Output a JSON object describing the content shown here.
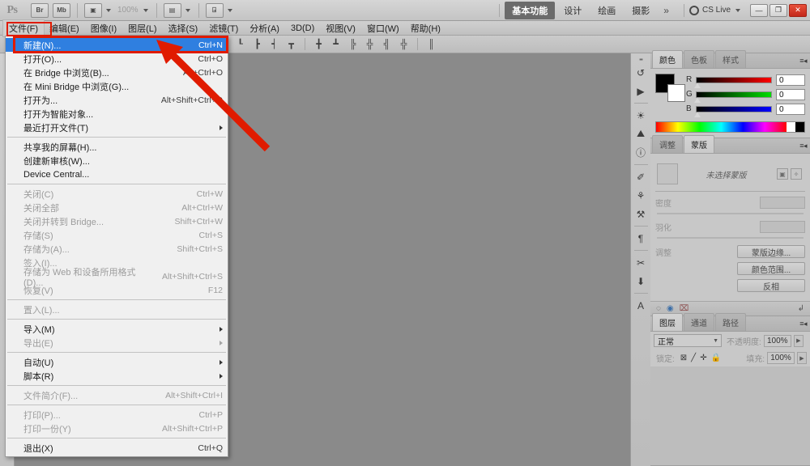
{
  "app": {
    "logo": "Ps",
    "zoom_level": "100%",
    "toolbar_icons": [
      {
        "name": "bridge-icon",
        "label": "Br"
      },
      {
        "name": "mini-bridge-icon",
        "label": "Mb"
      },
      {
        "name": "screen-mode-icon",
        "label": "▣"
      },
      {
        "name": "arrange-documents-icon",
        "label": "▤"
      },
      {
        "name": "extras-icon",
        "label": "⍈"
      }
    ]
  },
  "workspace": {
    "tabs": [
      {
        "name": "essentials",
        "label": "基本功能",
        "active": true
      },
      {
        "name": "design",
        "label": "设计",
        "active": false
      },
      {
        "name": "painting",
        "label": "绘画",
        "active": false
      },
      {
        "name": "photography",
        "label": "摄影",
        "active": false
      }
    ],
    "more": "»",
    "cs_live": "CS Live",
    "window_buttons": [
      {
        "name": "minimize-button",
        "glyph": "—"
      },
      {
        "name": "restore-button",
        "glyph": "❐"
      },
      {
        "name": "close-button",
        "glyph": "✕"
      }
    ]
  },
  "menubar": {
    "items": [
      {
        "name": "menu-file",
        "label": "文件(F)",
        "open": true
      },
      {
        "name": "menu-edit",
        "label": "编辑(E)",
        "open": false
      },
      {
        "name": "menu-image",
        "label": "图像(I)",
        "open": false
      },
      {
        "name": "menu-layer",
        "label": "图层(L)",
        "open": false
      },
      {
        "name": "menu-select",
        "label": "选择(S)",
        "open": false
      },
      {
        "name": "menu-filter",
        "label": "滤镜(T)",
        "open": false
      },
      {
        "name": "menu-analysis",
        "label": "分析(A)",
        "open": false
      },
      {
        "name": "menu-3d",
        "label": "3D(D)",
        "open": false
      },
      {
        "name": "menu-view",
        "label": "视图(V)",
        "open": false
      },
      {
        "name": "menu-window",
        "label": "窗口(W)",
        "open": false
      },
      {
        "name": "menu-help",
        "label": "帮助(H)",
        "open": false
      }
    ]
  },
  "options_bar": {
    "icons": [
      {
        "name": "align-left-edges-icon",
        "glyph": "┖"
      },
      {
        "name": "align-horizontal-centers-icon",
        "glyph": "┣"
      },
      {
        "name": "align-right-edges-icon",
        "glyph": "┥"
      },
      {
        "name": "align-top-edges-icon",
        "glyph": "┳"
      },
      {
        "name": "align-vertical-centers-icon",
        "glyph": "╋"
      },
      {
        "name": "align-bottom-edges-icon",
        "glyph": "┻"
      },
      {
        "name": "distribute-top-icon",
        "glyph": "╠"
      },
      {
        "name": "distribute-center-icon",
        "glyph": "╬"
      },
      {
        "name": "distribute-bottom-icon",
        "glyph": "╣"
      },
      {
        "name": "auto-align-layers-icon",
        "glyph": "║"
      }
    ]
  },
  "file_menu": {
    "items": [
      {
        "name": "menu-new",
        "label": "新建(N)...",
        "shortcut": "Ctrl+N",
        "selected": true,
        "disabled": false,
        "submenu": false
      },
      {
        "name": "menu-open",
        "label": "打开(O)...",
        "shortcut": "Ctrl+O",
        "selected": false,
        "disabled": false,
        "submenu": false
      },
      {
        "name": "menu-browse-in-bridge",
        "label": "在 Bridge 中浏览(B)...",
        "shortcut": "Alt+Ctrl+O",
        "selected": false,
        "disabled": false,
        "submenu": false
      },
      {
        "name": "menu-browse-in-mini-bridge",
        "label": "在 Mini Bridge 中浏览(G)...",
        "shortcut": "",
        "selected": false,
        "disabled": false,
        "submenu": false
      },
      {
        "name": "menu-open-as",
        "label": "打开为...",
        "shortcut": "Alt+Shift+Ctrl+O",
        "selected": false,
        "disabled": false,
        "submenu": false
      },
      {
        "name": "menu-open-as-smart-object",
        "label": "打开为智能对象...",
        "shortcut": "",
        "selected": false,
        "disabled": false,
        "submenu": false
      },
      {
        "name": "menu-open-recent",
        "label": "最近打开文件(T)",
        "shortcut": "",
        "selected": false,
        "disabled": false,
        "submenu": true
      },
      {
        "name": "separator-1",
        "label": "",
        "shortcut": "",
        "selected": false,
        "disabled": false,
        "submenu": false,
        "separator": true
      },
      {
        "name": "menu-share-my-screen",
        "label": "共享我的屏幕(H)...",
        "shortcut": "",
        "selected": false,
        "disabled": false,
        "submenu": false
      },
      {
        "name": "menu-create-new-review",
        "label": "创建新审核(W)...",
        "shortcut": "",
        "selected": false,
        "disabled": false,
        "submenu": false
      },
      {
        "name": "menu-device-central",
        "label": "Device Central...",
        "shortcut": "",
        "selected": false,
        "disabled": false,
        "submenu": false
      },
      {
        "name": "separator-2",
        "label": "",
        "shortcut": "",
        "selected": false,
        "disabled": false,
        "submenu": false,
        "separator": true
      },
      {
        "name": "menu-close",
        "label": "关闭(C)",
        "shortcut": "Ctrl+W",
        "selected": false,
        "disabled": true,
        "submenu": false
      },
      {
        "name": "menu-close-all",
        "label": "关闭全部",
        "shortcut": "Alt+Ctrl+W",
        "selected": false,
        "disabled": true,
        "submenu": false
      },
      {
        "name": "menu-close-and-go-to-bridge",
        "label": "关闭并转到 Bridge...",
        "shortcut": "Shift+Ctrl+W",
        "selected": false,
        "disabled": true,
        "submenu": false
      },
      {
        "name": "menu-save",
        "label": "存储(S)",
        "shortcut": "Ctrl+S",
        "selected": false,
        "disabled": true,
        "submenu": false
      },
      {
        "name": "menu-save-as",
        "label": "存储为(A)...",
        "shortcut": "Shift+Ctrl+S",
        "selected": false,
        "disabled": true,
        "submenu": false
      },
      {
        "name": "menu-check-in",
        "label": "签入(I)...",
        "shortcut": "",
        "selected": false,
        "disabled": true,
        "submenu": false
      },
      {
        "name": "menu-save-for-web",
        "label": "存储为 Web 和设备所用格式(D)...",
        "shortcut": "Alt+Shift+Ctrl+S",
        "selected": false,
        "disabled": true,
        "submenu": false
      },
      {
        "name": "menu-revert",
        "label": "恢复(V)",
        "shortcut": "F12",
        "selected": false,
        "disabled": true,
        "submenu": false
      },
      {
        "name": "separator-3",
        "label": "",
        "shortcut": "",
        "selected": false,
        "disabled": false,
        "submenu": false,
        "separator": true
      },
      {
        "name": "menu-place",
        "label": "置入(L)...",
        "shortcut": "",
        "selected": false,
        "disabled": true,
        "submenu": false
      },
      {
        "name": "separator-4",
        "label": "",
        "shortcut": "",
        "selected": false,
        "disabled": false,
        "submenu": false,
        "separator": true
      },
      {
        "name": "menu-import",
        "label": "导入(M)",
        "shortcut": "",
        "selected": false,
        "disabled": false,
        "submenu": true
      },
      {
        "name": "menu-export",
        "label": "导出(E)",
        "shortcut": "",
        "selected": false,
        "disabled": true,
        "submenu": true
      },
      {
        "name": "separator-5",
        "label": "",
        "shortcut": "",
        "selected": false,
        "disabled": false,
        "submenu": false,
        "separator": true
      },
      {
        "name": "menu-automate",
        "label": "自动(U)",
        "shortcut": "",
        "selected": false,
        "disabled": false,
        "submenu": true
      },
      {
        "name": "menu-scripts",
        "label": "脚本(R)",
        "shortcut": "",
        "selected": false,
        "disabled": false,
        "submenu": true
      },
      {
        "name": "separator-6",
        "label": "",
        "shortcut": "",
        "selected": false,
        "disabled": false,
        "submenu": false,
        "separator": true
      },
      {
        "name": "menu-file-info",
        "label": "文件简介(F)...",
        "shortcut": "Alt+Shift+Ctrl+I",
        "selected": false,
        "disabled": true,
        "submenu": false
      },
      {
        "name": "separator-7",
        "label": "",
        "shortcut": "",
        "selected": false,
        "disabled": false,
        "submenu": false,
        "separator": true
      },
      {
        "name": "menu-print",
        "label": "打印(P)...",
        "shortcut": "Ctrl+P",
        "selected": false,
        "disabled": true,
        "submenu": false
      },
      {
        "name": "menu-print-one-copy",
        "label": "打印一份(Y)",
        "shortcut": "Alt+Shift+Ctrl+P",
        "selected": false,
        "disabled": true,
        "submenu": false
      },
      {
        "name": "separator-8",
        "label": "",
        "shortcut": "",
        "selected": false,
        "disabled": false,
        "submenu": false,
        "separator": true
      },
      {
        "name": "menu-exit",
        "label": "退出(X)",
        "shortcut": "Ctrl+Q",
        "selected": false,
        "disabled": false,
        "submenu": false
      }
    ]
  },
  "dock_rail": {
    "icons": [
      {
        "name": "history-icon",
        "glyph": "↺"
      },
      {
        "name": "actions-icon",
        "glyph": "▶"
      },
      {
        "name": "adjustments-icon",
        "glyph": "☀"
      },
      {
        "name": "masks-icon",
        "glyph": "⛰"
      },
      {
        "name": "info-icon",
        "glyph": "ⓘ"
      },
      {
        "name": "brush-presets-icon",
        "glyph": "✐"
      },
      {
        "name": "clone-source-icon",
        "glyph": "⚘"
      },
      {
        "name": "tool-presets-icon",
        "glyph": "⚒"
      },
      {
        "name": "paragraph-icon",
        "glyph": "¶"
      },
      {
        "name": "tools-icon",
        "glyph": "✂"
      },
      {
        "name": "measurement-icon",
        "glyph": "⬇"
      },
      {
        "name": "character-icon",
        "glyph": "A"
      }
    ]
  },
  "color_panel": {
    "tabs": [
      {
        "name": "tab-color",
        "label": "颜色",
        "active": true
      },
      {
        "name": "tab-swatches",
        "label": "色板",
        "active": false
      },
      {
        "name": "tab-styles",
        "label": "样式",
        "active": false
      }
    ],
    "foreground_color": "#000000",
    "background_color": "#ffffff",
    "channels": [
      {
        "name": "red-channel",
        "label": "R",
        "value": "0"
      },
      {
        "name": "green-channel",
        "label": "G",
        "value": "0"
      },
      {
        "name": "blue-channel",
        "label": "B",
        "value": "0"
      }
    ]
  },
  "masks_panel": {
    "tabs": [
      {
        "name": "tab-adjustments",
        "label": "调整",
        "active": false
      },
      {
        "name": "tab-masks",
        "label": "蒙版",
        "active": true
      }
    ],
    "status": "未选择蒙版",
    "density_label": "密度",
    "density_value": "",
    "feather_label": "羽化",
    "feather_value": "",
    "adjust_label": "调整",
    "buttons": [
      {
        "name": "mask-edge-button",
        "label": "蒙版边缘..."
      },
      {
        "name": "color-range-button",
        "label": "颜色范围..."
      },
      {
        "name": "invert-button",
        "label": "反相"
      }
    ],
    "footer_icons": [
      {
        "name": "load-selection-icon",
        "glyph": "◌"
      },
      {
        "name": "toggle-mask-icon",
        "glyph": "◉"
      },
      {
        "name": "delete-mask-icon",
        "glyph": "⌧"
      },
      {
        "name": "apply-mask-icon",
        "glyph": "↲"
      }
    ]
  },
  "layers_panel": {
    "tabs": [
      {
        "name": "tab-layers",
        "label": "图层",
        "active": true
      },
      {
        "name": "tab-channels",
        "label": "通道",
        "active": false
      },
      {
        "name": "tab-paths",
        "label": "路径",
        "active": false
      }
    ],
    "blend_mode": "正常",
    "opacity_label": "不透明度:",
    "opacity_value": "100%",
    "lock_label": "锁定:",
    "fill_label": "填充:",
    "fill_value": "100%",
    "lock_icons": [
      {
        "name": "lock-transparent-pixels-icon",
        "glyph": "⊠"
      },
      {
        "name": "lock-image-pixels-icon",
        "glyph": "╱"
      },
      {
        "name": "lock-position-icon",
        "glyph": "✛"
      },
      {
        "name": "lock-all-icon",
        "glyph": "ὑ2"
      }
    ]
  },
  "annotation": {
    "arrow_color": "#e01b00",
    "highlight_color": "#e01b00"
  }
}
